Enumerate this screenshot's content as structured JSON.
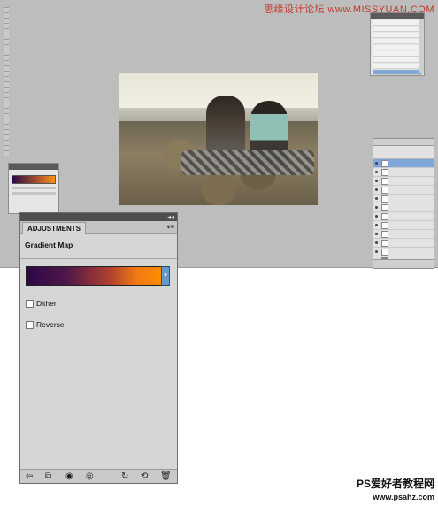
{
  "watermark_top": "思缘设计论坛 www.MISSYUAN.COM",
  "watermark_bottom": {
    "line1": "PS爱好者教程网",
    "line2": "www.psahz.com"
  },
  "adjustments_panel": {
    "tab_label": "ADJUSTMENTS",
    "title": "Gradient Map",
    "gradient_colors": [
      "#2b0848",
      "#ff8c00"
    ],
    "dither_label": "Dither",
    "dither_checked": false,
    "reverse_label": "Reverse",
    "reverse_checked": false,
    "collapse_glyph": "◂◂",
    "menu_glyph": "▾≡"
  },
  "footer_icons": [
    {
      "name": "return-arrow-icon",
      "glyph": "⇦"
    },
    {
      "name": "expand-view-icon",
      "glyph": "⧉"
    },
    {
      "name": "clip-to-layer-icon",
      "glyph": "◉"
    },
    {
      "name": "visibility-eye-icon",
      "glyph": "◎"
    },
    {
      "name": "view-previous-icon",
      "glyph": "↻"
    },
    {
      "name": "reset-icon",
      "glyph": "⟲"
    },
    {
      "name": "trash-icon",
      "glyph": "🗑"
    }
  ]
}
